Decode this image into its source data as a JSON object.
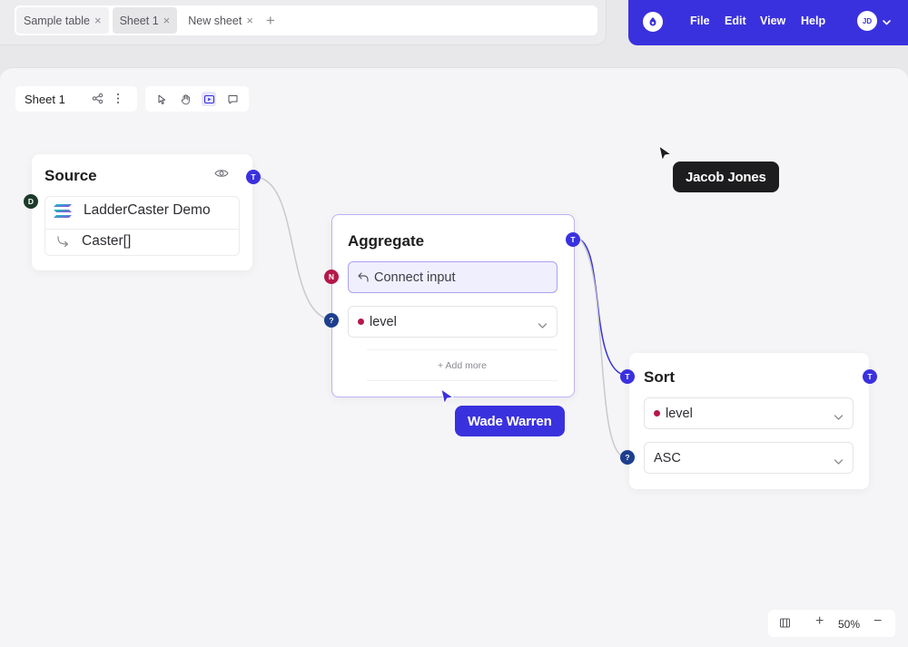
{
  "tabs": [
    {
      "label": "Sample table",
      "active": false
    },
    {
      "label": "Sheet 1",
      "active": true
    },
    {
      "label": "New sheet",
      "active": false
    }
  ],
  "menu": {
    "items": [
      "File",
      "Edit",
      "View",
      "Help"
    ],
    "user_initials": "JD"
  },
  "sheet_toolbar": {
    "sheet_name": "Sheet 1"
  },
  "tools": [
    "select-tool",
    "hand-tool",
    "frame-tool",
    "comment-tool"
  ],
  "nodes": {
    "source": {
      "title": "Source",
      "items": [
        "LadderCaster Demo",
        "Caster[]"
      ],
      "port_left": "D",
      "port_right": "T"
    },
    "aggregate": {
      "title": "Aggregate",
      "connect_label": "Connect input",
      "field_value": "level",
      "add_more": "+ Add more",
      "port_n": "N",
      "port_q": "?",
      "port_out": "T"
    },
    "sort": {
      "title": "Sort",
      "field_value": "level",
      "order_value": "ASC",
      "port_in": "T",
      "port_q": "?",
      "port_out": "T"
    }
  },
  "cursors": {
    "jacob": "Jacob Jones",
    "wade": "Wade Warren"
  },
  "zoom": {
    "level": "50%"
  },
  "colors": {
    "accent": "#3a31de",
    "cursor_dark": "#1d1d1f",
    "node_border_active": "#b9b3f3",
    "required": "#b5184a",
    "optional": "#1d3f8e"
  }
}
